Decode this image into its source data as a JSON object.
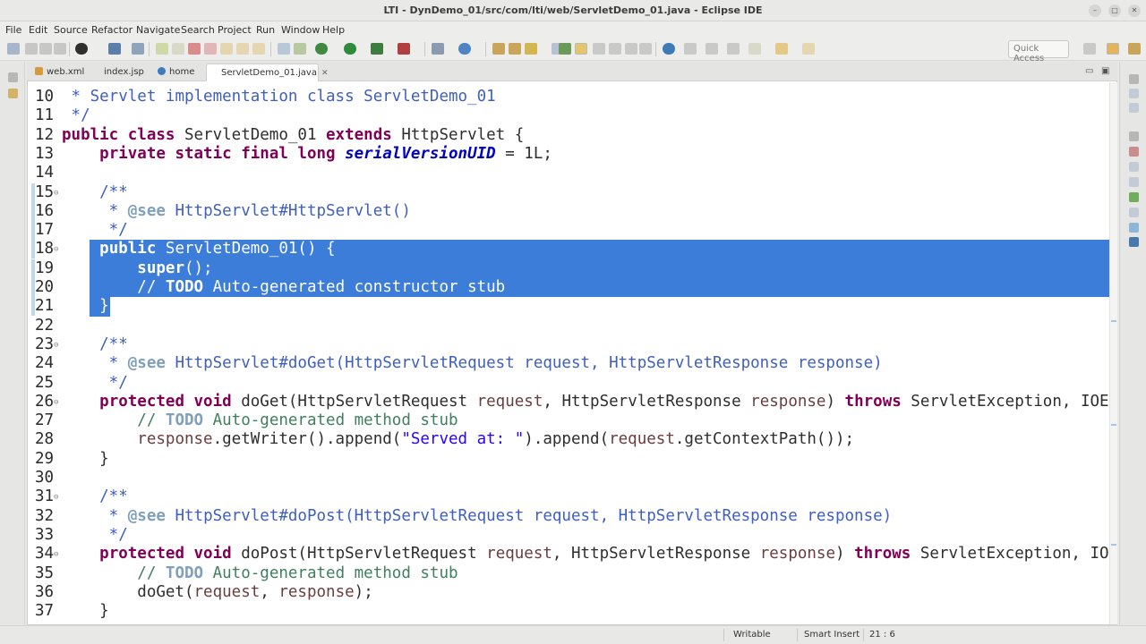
{
  "window": {
    "title": "LTI - DynDemo_01/src/com/lti/web/ServletDemo_01.java - Eclipse IDE"
  },
  "menu": [
    "File",
    "Edit",
    "Source",
    "Refactor",
    "Navigate",
    "Search",
    "Project",
    "Run",
    "Window",
    "Help"
  ],
  "toolbar": {
    "quick_access": "Quick Access"
  },
  "tabs": [
    {
      "label": "web.xml",
      "icon": "xml-file-icon",
      "color": "#d59b3b"
    },
    {
      "label": "index.jsp",
      "icon": "jsp-file-icon",
      "color": "#5a8fd1"
    },
    {
      "label": "home",
      "icon": "globe-icon",
      "color": "#3d7bbf"
    },
    {
      "label": "ServletDemo_01.java",
      "icon": "java-file-icon",
      "color": "#6b8fc2",
      "active": true
    }
  ],
  "editor": {
    "lines": [
      {
        "n": "10",
        "segs": [
          {
            "t": " * ",
            "c": "cm"
          },
          {
            "t": "Servlet",
            "c": "cm"
          },
          {
            "t": " implementation class ServletDemo_01",
            "c": "cm"
          }
        ]
      },
      {
        "n": "11",
        "segs": [
          {
            "t": " */",
            "c": "cm"
          }
        ]
      },
      {
        "n": "12",
        "segs": [
          {
            "t": "public class",
            "c": "kw"
          },
          {
            "t": " ServletDemo_01 ",
            "c": ""
          },
          {
            "t": "extends",
            "c": "kw"
          },
          {
            "t": " HttpServlet {",
            "c": ""
          }
        ]
      },
      {
        "n": "13",
        "segs": [
          {
            "t": "    ",
            "c": ""
          },
          {
            "t": "private static final long",
            "c": "kw"
          },
          {
            "t": " ",
            "c": ""
          },
          {
            "t": "serialVersionUID",
            "c": "fld"
          },
          {
            "t": " = 1L;",
            "c": ""
          }
        ]
      },
      {
        "n": "14",
        "segs": []
      },
      {
        "n": "15",
        "fold": true,
        "mark": true,
        "segs": [
          {
            "t": "    /**",
            "c": "cm"
          }
        ]
      },
      {
        "n": "16",
        "mark": true,
        "segs": [
          {
            "t": "     * ",
            "c": "cm"
          },
          {
            "t": "@see",
            "c": "tg"
          },
          {
            "t": " HttpServlet#HttpServlet()",
            "c": "cm"
          }
        ]
      },
      {
        "n": "17",
        "mark": true,
        "segs": [
          {
            "t": "     */",
            "c": "cm"
          }
        ]
      },
      {
        "n": "18",
        "fold": true,
        "mark": true,
        "selected": true,
        "segs": [
          {
            "t": "    ",
            "c": ""
          },
          {
            "t": "public",
            "c": "kw"
          },
          {
            "t": " ServletDemo_01() {",
            "c": ""
          }
        ]
      },
      {
        "n": "19",
        "mark": true,
        "selected": true,
        "segs": [
          {
            "t": "        ",
            "c": ""
          },
          {
            "t": "super",
            "c": "kw"
          },
          {
            "t": "();",
            "c": ""
          }
        ]
      },
      {
        "n": "20",
        "mark": true,
        "selected": true,
        "segs": [
          {
            "t": "        // ",
            "c": "lc"
          },
          {
            "t": "TODO",
            "c": "todo"
          },
          {
            "t": " Auto-generated constructor stub",
            "c": "lc"
          }
        ]
      },
      {
        "n": "21",
        "mark": true,
        "selected": true,
        "partial": true,
        "segs": [
          {
            "t": "    }",
            "c": ""
          }
        ]
      },
      {
        "n": "22",
        "segs": []
      },
      {
        "n": "23",
        "fold": true,
        "segs": [
          {
            "t": "    /**",
            "c": "cm"
          }
        ]
      },
      {
        "n": "24",
        "segs": [
          {
            "t": "     * ",
            "c": "cm"
          },
          {
            "t": "@see",
            "c": "tg"
          },
          {
            "t": " HttpServlet#doGet(HttpServletRequest request, HttpServletResponse response)",
            "c": "cm"
          }
        ]
      },
      {
        "n": "25",
        "segs": [
          {
            "t": "     */",
            "c": "cm"
          }
        ]
      },
      {
        "n": "26",
        "fold": true,
        "segs": [
          {
            "t": "    ",
            "c": ""
          },
          {
            "t": "protected void",
            "c": "kw"
          },
          {
            "t": " doGet(HttpServletRequest ",
            "c": ""
          },
          {
            "t": "request",
            "c": "par"
          },
          {
            "t": ", HttpServletResponse ",
            "c": ""
          },
          {
            "t": "response",
            "c": "par"
          },
          {
            "t": ") ",
            "c": ""
          },
          {
            "t": "throws",
            "c": "kw"
          },
          {
            "t": " ServletException, IOException {",
            "c": ""
          }
        ]
      },
      {
        "n": "27",
        "segs": [
          {
            "t": "        // ",
            "c": "lc"
          },
          {
            "t": "TODO",
            "c": "todo"
          },
          {
            "t": " Auto-generated method stub",
            "c": "lc"
          }
        ]
      },
      {
        "n": "28",
        "segs": [
          {
            "t": "        ",
            "c": ""
          },
          {
            "t": "response",
            "c": "par"
          },
          {
            "t": ".getWriter().append(",
            "c": ""
          },
          {
            "t": "\"Served at: \"",
            "c": "str"
          },
          {
            "t": ").append(",
            "c": ""
          },
          {
            "t": "request",
            "c": "par"
          },
          {
            "t": ".getContextPath());",
            "c": ""
          }
        ]
      },
      {
        "n": "29",
        "segs": [
          {
            "t": "    }",
            "c": ""
          }
        ]
      },
      {
        "n": "30",
        "segs": []
      },
      {
        "n": "31",
        "fold": true,
        "segs": [
          {
            "t": "    /**",
            "c": "cm"
          }
        ]
      },
      {
        "n": "32",
        "segs": [
          {
            "t": "     * ",
            "c": "cm"
          },
          {
            "t": "@see",
            "c": "tg"
          },
          {
            "t": " HttpServlet#doPost(HttpServletRequest request, HttpServletResponse response)",
            "c": "cm"
          }
        ]
      },
      {
        "n": "33",
        "segs": [
          {
            "t": "     */",
            "c": "cm"
          }
        ]
      },
      {
        "n": "34",
        "fold": true,
        "segs": [
          {
            "t": "    ",
            "c": ""
          },
          {
            "t": "protected void",
            "c": "kw"
          },
          {
            "t": " doPost(HttpServletRequest ",
            "c": ""
          },
          {
            "t": "request",
            "c": "par"
          },
          {
            "t": ", HttpServletResponse ",
            "c": ""
          },
          {
            "t": "response",
            "c": "par"
          },
          {
            "t": ") ",
            "c": ""
          },
          {
            "t": "throws",
            "c": "kw"
          },
          {
            "t": " ServletException, IOException {",
            "c": ""
          }
        ]
      },
      {
        "n": "35",
        "segs": [
          {
            "t": "        // ",
            "c": "lc"
          },
          {
            "t": "TODO",
            "c": "todo"
          },
          {
            "t": " Auto-generated method stub",
            "c": "lc"
          }
        ]
      },
      {
        "n": "36",
        "segs": [
          {
            "t": "        doGet(",
            "c": ""
          },
          {
            "t": "request",
            "c": "par"
          },
          {
            "t": ", ",
            "c": ""
          },
          {
            "t": "response",
            "c": "par"
          },
          {
            "t": ");",
            "c": ""
          }
        ]
      },
      {
        "n": "37",
        "segs": [
          {
            "t": "    }",
            "c": ""
          }
        ]
      }
    ]
  },
  "status": {
    "writable": "Writable",
    "insert_mode": "Smart Insert",
    "position": "21 : 6"
  },
  "colors": {
    "selection": "#3b7dd8",
    "keyword": "#7f0055",
    "javadoc": "#3f5fbf",
    "comment": "#3f7f5f"
  }
}
